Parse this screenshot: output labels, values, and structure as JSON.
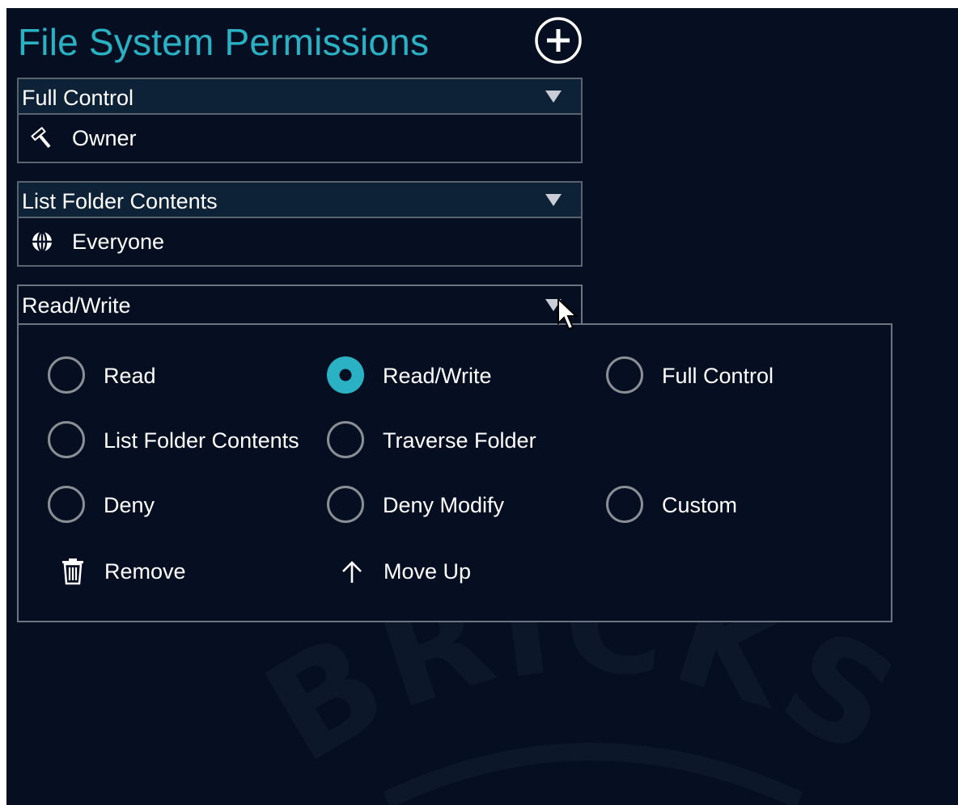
{
  "title": "File System Permissions",
  "permissions": [
    {
      "level": "Full Control",
      "principal": "Owner",
      "principal_icon": "hammer-icon"
    },
    {
      "level": "List Folder Contents",
      "principal": "Everyone",
      "principal_icon": "globe-icon"
    }
  ],
  "active_permission": {
    "level": "Read/Write",
    "options": {
      "read": "Read",
      "read_write": "Read/Write",
      "full_control": "Full Control",
      "list_folder_contents": "List Folder Contents",
      "traverse_folder": "Traverse Folder",
      "deny": "Deny",
      "deny_modify": "Deny Modify",
      "custom": "Custom"
    },
    "selected": "Read/Write",
    "actions": {
      "remove": "Remove",
      "move_up": "Move Up"
    }
  },
  "colors": {
    "background": "#060f21",
    "accent": "#2ab2c4",
    "header_bg": "#0d2236",
    "border": "#5a6370"
  },
  "watermark": "BRICKSTOR"
}
